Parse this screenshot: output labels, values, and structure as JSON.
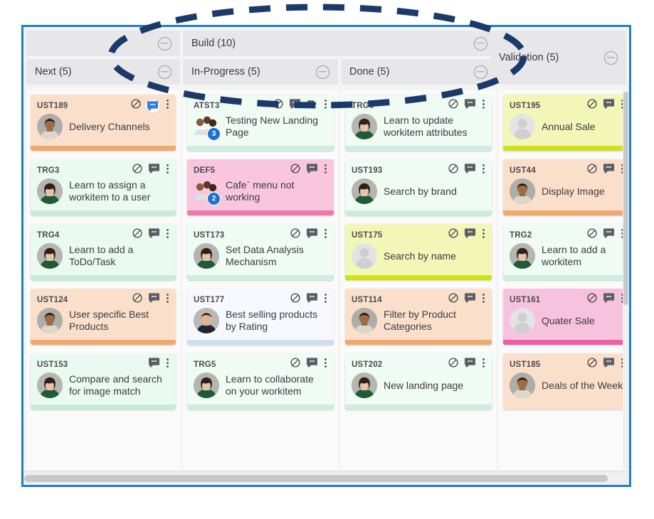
{
  "board": {
    "accent_border_color": "#1f7fc4",
    "header_bg": "#e7e7e9",
    "lane_bg": "#fafafa"
  },
  "headers": {
    "row1": [
      {
        "label": "",
        "collapse_icon": "collapse-circle-minus-icon"
      },
      {
        "label": "Build (10)",
        "collapse_icon": "collapse-circle-minus-icon"
      },
      {
        "label": "Validation (5)",
        "collapse_icon": "collapse-circle-minus-icon"
      }
    ],
    "row2": [
      {
        "label": "Next (5)",
        "collapse_icon": "collapse-circle-minus-icon"
      },
      {
        "label": "In-Progress (5)",
        "collapse_icon": "collapse-circle-minus-icon"
      },
      {
        "label": "Done (5)",
        "collapse_icon": "collapse-circle-minus-icon"
      }
    ]
  },
  "columns": [
    {
      "key": "next",
      "name": "Next (5)",
      "cards": [
        {
          "id": "UST189",
          "title": "Delivery Channels",
          "bg": "#fae0cb",
          "foot": "#efa96b",
          "icons": [
            "blocked-icon",
            "comment-icon-active",
            "more-options-icon"
          ],
          "avatar": "man-avatar",
          "badge": ""
        },
        {
          "id": "TRG3",
          "title": "Learn to assign a workitem to a user",
          "bg": "#eafaf0",
          "foot": "#c6ecd8",
          "icons": [
            "blocked-icon",
            "comment-icon",
            "more-options-icon"
          ],
          "avatar": "woman-avatar",
          "badge": ""
        },
        {
          "id": "TRG4",
          "title": "Learn to add a ToDo/Task",
          "bg": "#eafaf0",
          "foot": "#c6ecd8",
          "icons": [
            "blocked-icon",
            "comment-icon",
            "more-options-icon"
          ],
          "avatar": "woman-avatar",
          "badge": ""
        },
        {
          "id": "UST124",
          "title": "User specific Best Products",
          "bg": "#fae0cb",
          "foot": "#efa96b",
          "icons": [
            "blocked-icon",
            "comment-icon",
            "more-options-icon"
          ],
          "avatar": "man-avatar",
          "badge": ""
        },
        {
          "id": "UST153",
          "title": "Compare and search for image match",
          "bg": "#eafaf0",
          "foot": "#c6ecd8",
          "icons": [
            "comment-icon",
            "more-options-icon"
          ],
          "avatar": "woman-avatar",
          "badge": ""
        }
      ]
    },
    {
      "key": "in-progress",
      "name": "In-Progress (5)",
      "cards": [
        {
          "id": "ATST3",
          "title": "Testing New Landing Page",
          "bg": "#effbf3",
          "foot": "#cdeedc",
          "icons": [
            "blocked-icon",
            "comment-icon",
            "tag-icon",
            "more-options-icon"
          ],
          "avatar": "group-avatar",
          "badge": "3"
        },
        {
          "id": "DEF5",
          "title": "Cafe` menu not working",
          "bg": "#f9c6dd",
          "foot": "#ef77ae",
          "icons": [
            "blocked-icon",
            "comment-icon",
            "more-options-icon"
          ],
          "avatar": "group-avatar",
          "badge": "2"
        },
        {
          "id": "UST173",
          "title": "Set Data Analysis Mechanism",
          "bg": "#effbf3",
          "foot": "#cdeedc",
          "icons": [
            "blocked-icon",
            "comment-icon",
            "more-options-icon"
          ],
          "avatar": "woman-avatar",
          "badge": ""
        },
        {
          "id": "UST177",
          "title": "Best selling products by Rating",
          "bg": "#f6f8fd",
          "foot": "#cfddf3",
          "icons": [
            "blocked-icon",
            "comment-icon",
            "more-options-icon"
          ],
          "avatar": "man2-avatar",
          "badge": ""
        },
        {
          "id": "TRG5",
          "title": "Learn to collaborate on your workitem",
          "bg": "#effbf3",
          "foot": "#cdeedc",
          "icons": [
            "blocked-icon",
            "comment-icon",
            "more-options-icon"
          ],
          "avatar": "woman-avatar",
          "badge": ""
        }
      ]
    },
    {
      "key": "done",
      "name": "Done (5)",
      "cards": [
        {
          "id": "TRG6",
          "title": "Learn to update workitem attributes",
          "bg": "#effbf3",
          "foot": "#cdeedc",
          "icons": [
            "blocked-icon",
            "comment-icon",
            "more-options-icon"
          ],
          "avatar": "woman-avatar",
          "badge": ""
        },
        {
          "id": "UST193",
          "title": "Search by brand",
          "bg": "#effbf3",
          "foot": "#cdeedc",
          "icons": [
            "blocked-icon",
            "comment-icon",
            "more-options-icon"
          ],
          "avatar": "woman-avatar",
          "badge": ""
        },
        {
          "id": "UST175",
          "title": "Search by name",
          "bg": "#f2f7b8",
          "foot": "#cfe215",
          "icons": [
            "blocked-icon",
            "comment-icon",
            "more-options-icon"
          ],
          "avatar": "placeholder-avatar",
          "badge": ""
        },
        {
          "id": "UST114",
          "title": "Filter by Product Categories",
          "bg": "#fae0cb",
          "foot": "#efa96b",
          "icons": [
            "blocked-icon",
            "comment-icon",
            "more-options-icon"
          ],
          "avatar": "man-avatar",
          "badge": ""
        },
        {
          "id": "UST202",
          "title": "New landing page",
          "bg": "#effbf3",
          "foot": "#cdeedc",
          "icons": [
            "blocked-icon",
            "comment-icon",
            "more-options-icon"
          ],
          "avatar": "woman-avatar",
          "badge": ""
        }
      ]
    },
    {
      "key": "validation",
      "name": "Validation (5)",
      "cards": [
        {
          "id": "UST195",
          "title": "Annual Sale",
          "bg": "#f2f7b8",
          "foot": "#cfe215",
          "icons": [
            "blocked-icon",
            "comment-icon",
            "more-options-icon"
          ],
          "avatar": "placeholder-avatar",
          "badge": ""
        },
        {
          "id": "UST44",
          "title": "Display Image",
          "bg": "#fae0cb",
          "foot": "#efa96b",
          "icons": [
            "blocked-icon",
            "comment-icon",
            "more-options-icon"
          ],
          "avatar": "man-avatar",
          "badge": ""
        },
        {
          "id": "TRG2",
          "title": "Learn to add a workitem",
          "bg": "#effbf3",
          "foot": "#cdeedc",
          "icons": [
            "blocked-icon",
            "comment-icon",
            "more-options-icon"
          ],
          "avatar": "woman-avatar",
          "badge": ""
        },
        {
          "id": "UST161",
          "title": "Quater Sale",
          "bg": "#f7c2dd",
          "foot": "#ef5fa6",
          "icons": [
            "blocked-icon",
            "comment-icon",
            "more-options-icon"
          ],
          "avatar": "placeholder-avatar",
          "badge": ""
        },
        {
          "id": "UST185",
          "title": "Deals of the Week",
          "bg": "#fae0cb",
          "foot": "#fae0cb",
          "icons": [
            "blocked-icon",
            "comment-icon",
            "more-options-icon"
          ],
          "avatar": "man-avatar",
          "badge": ""
        }
      ]
    }
  ],
  "annotation": {
    "shape": "dashed-ellipse",
    "color": "#1b3a6b"
  },
  "scrollbars": {
    "horizontal": "horizontal-scrollbar",
    "vertical": "vertical-scrollbar"
  }
}
